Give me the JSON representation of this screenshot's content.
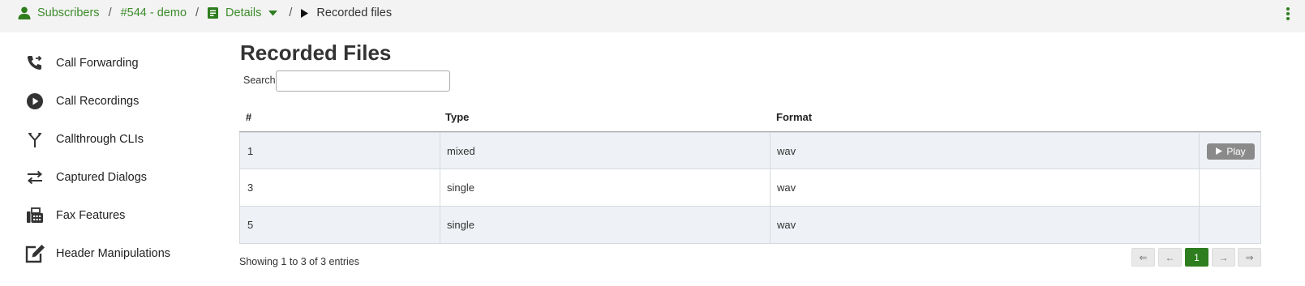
{
  "breadcrumb": {
    "subscribers": "Subscribers",
    "separator": "/",
    "subscriber": "#544 - demo",
    "details": "Details",
    "current": "Recorded files"
  },
  "icons": {
    "user": "user-icon",
    "details": "document-icon",
    "caret": "caret-down-icon",
    "current": "play-icon",
    "menu": "kebab-menu-icon"
  },
  "sidebar": {
    "items": [
      {
        "label": "Call Forwarding",
        "icon": "call-forward-icon"
      },
      {
        "label": "Call Recordings",
        "icon": "play-circle-icon"
      },
      {
        "label": "Callthrough CLIs",
        "icon": "split-arrow-icon"
      },
      {
        "label": "Captured Dialogs",
        "icon": "exchange-icon"
      },
      {
        "label": "Fax Features",
        "icon": "fax-icon"
      },
      {
        "label": "Header Manipulations",
        "icon": "edit-icon"
      }
    ]
  },
  "main": {
    "title": "Recorded Files",
    "search_label": "Search:",
    "search_value": "",
    "table": {
      "headers": [
        "#",
        "Type",
        "Format",
        ""
      ],
      "rows": [
        {
          "id": "1",
          "type": "mixed",
          "format": "wav",
          "action": "Play"
        },
        {
          "id": "3",
          "type": "single",
          "format": "wav",
          "action": ""
        },
        {
          "id": "5",
          "type": "single",
          "format": "wav",
          "action": ""
        }
      ]
    },
    "info": "Showing 1 to 3 of 3 entries",
    "pagination": {
      "first": "⇐",
      "prev": "←",
      "current": "1",
      "next": "→",
      "last": "⇒"
    }
  },
  "colors": {
    "accent": "#3c8c2b",
    "active_page": "#2e7d1e",
    "play_button": "#8a8a8a",
    "row_stripe": "#eef1f5",
    "topbar": "#f3f3f3"
  }
}
